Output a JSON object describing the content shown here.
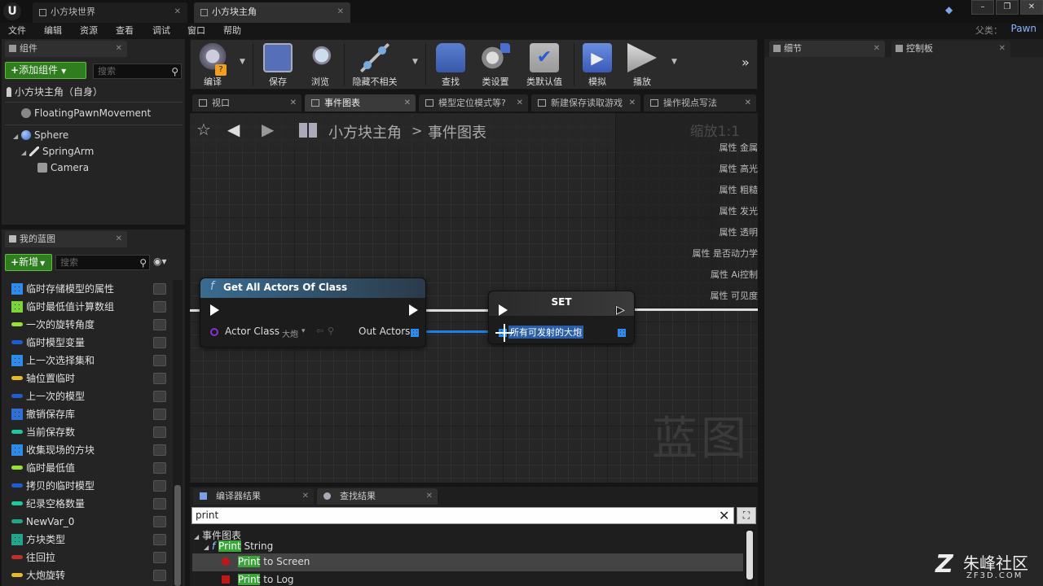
{
  "window": {
    "tabs": [
      {
        "label": "小方块世界"
      },
      {
        "label": "小方块主角"
      }
    ],
    "parent_label": "父类：",
    "parent_value": "Pawn"
  },
  "menu": [
    "文件",
    "编辑",
    "资源",
    "查看",
    "调试",
    "窗口",
    "帮助"
  ],
  "components": {
    "tab_label": "组件",
    "add_button": "添加组件",
    "search_placeholder": "搜索",
    "root_item": "小方块主角（自身）",
    "items": [
      "FloatingPawnMovement",
      "Sphere",
      "SpringArm",
      "Camera"
    ]
  },
  "myblueprint": {
    "tab_label": "我的蓝图",
    "new_button": "新增",
    "search_placeholder": "搜索",
    "variables": [
      {
        "label": "临时存储模型的属性",
        "color": "#2f8bea",
        "kind": "grid"
      },
      {
        "label": "临时最低值计算数组",
        "color": "#7ad43a",
        "kind": "grid"
      },
      {
        "label": "一次的旋转角度",
        "color": "#9ae03a",
        "kind": "pill"
      },
      {
        "label": "临时模型变量",
        "color": "#1d5fd0",
        "kind": "pill"
      },
      {
        "label": "上一次选择集和",
        "color": "#2f8bea",
        "kind": "grid"
      },
      {
        "label": "轴位置临时",
        "color": "#e6b82e",
        "kind": "pill"
      },
      {
        "label": "上一次的模型",
        "color": "#1d5fd0",
        "kind": "pill"
      },
      {
        "label": "撤销保存库",
        "color": "#2f6fd6",
        "kind": "grid"
      },
      {
        "label": "当前保存数",
        "color": "#22c7a0",
        "kind": "pill"
      },
      {
        "label": "收集现场的方块",
        "color": "#2f8bea",
        "kind": "grid"
      },
      {
        "label": "临时最低值",
        "color": "#9ae03a",
        "kind": "pill"
      },
      {
        "label": "拷贝的临时模型",
        "color": "#1d5fd0",
        "kind": "pill"
      },
      {
        "label": "纪录空格数量",
        "color": "#22c7a0",
        "kind": "pill"
      },
      {
        "label": "NewVar_0",
        "color": "#22a58a",
        "kind": "pill"
      },
      {
        "label": "方块类型",
        "color": "#22a58a",
        "kind": "grid"
      },
      {
        "label": "往回拉",
        "color": "#c0302a",
        "kind": "pill"
      },
      {
        "label": "大炮旋转",
        "color": "#e6b82e",
        "kind": "pill"
      }
    ]
  },
  "toolbar": {
    "buttons": [
      {
        "label": "编译"
      },
      {
        "label": "保存"
      },
      {
        "label": "浏览"
      },
      {
        "label": "隐藏不相关"
      },
      {
        "label": "查找"
      },
      {
        "label": "类设置"
      },
      {
        "label": "类默认值"
      },
      {
        "label": "模拟"
      },
      {
        "label": "播放"
      }
    ]
  },
  "doc_tabs": [
    "视口",
    "事件图表",
    "模型定位模式等?",
    "新建保存读取游戏",
    "操作视点写法"
  ],
  "graph": {
    "breadcrumb_root": "小方块主角",
    "breadcrumb_sep": ">",
    "breadcrumb_leaf": "事件图表",
    "zoom": "缩放1:1",
    "properties": [
      "属性 金属",
      "属性 高光",
      "属性 粗糙",
      "属性 发光",
      "属性 透明",
      "属性 是否动力学",
      "属性 Ai控制",
      "属性 可见度"
    ],
    "watermark": "蓝图",
    "node_get": {
      "title": "Get All Actors Of Class",
      "pin_in": "Actor Class",
      "pin_value": "大炮",
      "pin_out": "Out Actors"
    },
    "node_set": {
      "title": "SET",
      "var_label": "所有可发射的大炮"
    }
  },
  "right_panel": {
    "details_tab": "细节",
    "palette_tab": "控制板"
  },
  "bottom": {
    "compiler_tab": "编译器结果",
    "find_tab": "查找结果",
    "query": "print",
    "results_root": "事件图表",
    "results": [
      {
        "match": "Print",
        "rest": " String"
      },
      {
        "match": "Print",
        "rest": " to Screen"
      },
      {
        "match": "Print",
        "rest": " to Log"
      }
    ]
  },
  "brand": {
    "name": "朱峰社区",
    "url": "ZF3D.COM"
  }
}
